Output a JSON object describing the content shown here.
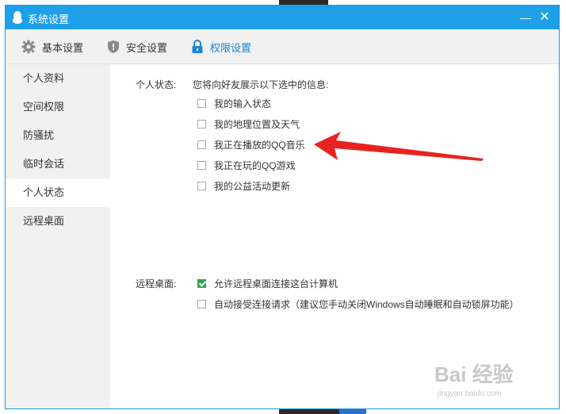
{
  "window": {
    "title": "系统设置",
    "minimize_glyph": "—",
    "close_glyph": "✕"
  },
  "toolbar": {
    "tabs": [
      {
        "label": "基本设置",
        "icon": "gear-icon"
      },
      {
        "label": "安全设置",
        "icon": "shield-icon"
      },
      {
        "label": "权限设置",
        "icon": "lock-icon",
        "active": true
      }
    ],
    "active_color": "#1c86d8"
  },
  "sidebar": {
    "items": [
      {
        "label": "个人资料"
      },
      {
        "label": "空间权限"
      },
      {
        "label": "防骚扰"
      },
      {
        "label": "临时会话"
      },
      {
        "label": "个人状态",
        "active": true
      },
      {
        "label": "远程桌面"
      }
    ]
  },
  "status_section": {
    "label": "个人状态:",
    "description": "您将向好友展示以下选中的信息:",
    "options": [
      {
        "label": "我的输入状态",
        "checked": false
      },
      {
        "label": "我的地理位置及天气",
        "checked": false
      },
      {
        "label": "我正在播放的QQ音乐",
        "checked": false
      },
      {
        "label": "我正在玩的QQ游戏",
        "checked": false
      },
      {
        "label": "我的公益活动更新",
        "checked": false
      }
    ]
  },
  "remote_section": {
    "label": "远程桌面:",
    "options": [
      {
        "label": "允许远程桌面连接这台计算机",
        "checked": true
      },
      {
        "label": "自动接受连接请求（建议您手动关闭Windows自动睡眠和自动锁屏功能）",
        "checked": false
      }
    ]
  },
  "watermark": {
    "logo": "Bai 经验",
    "sub": "jingyan.baidu.com"
  },
  "colors": {
    "titlebar": "#1ea0e8",
    "arrow": "#e8231f",
    "checked": "#2fa84f"
  }
}
